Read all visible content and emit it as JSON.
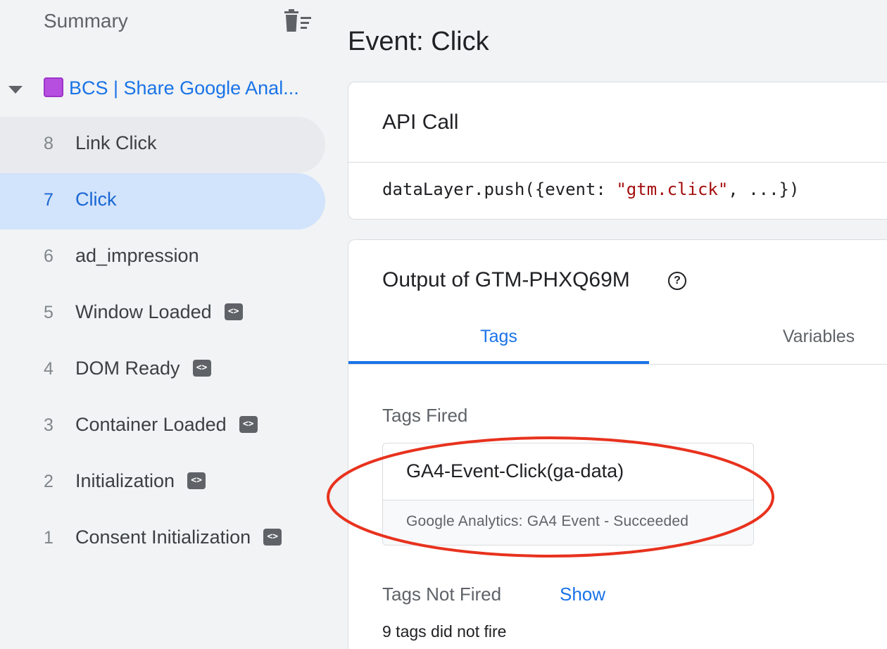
{
  "sidebar": {
    "summary_label": "Summary",
    "container_label": "BCS | Share Google Anal...",
    "events": [
      {
        "num": "8",
        "label": "Link Click",
        "badge": false,
        "state": "hover"
      },
      {
        "num": "7",
        "label": "Click",
        "badge": false,
        "state": "active"
      },
      {
        "num": "6",
        "label": "ad_impression",
        "badge": false,
        "state": ""
      },
      {
        "num": "5",
        "label": "Window Loaded",
        "badge": true,
        "state": ""
      },
      {
        "num": "4",
        "label": "DOM Ready",
        "badge": true,
        "state": ""
      },
      {
        "num": "3",
        "label": "Container Loaded",
        "badge": true,
        "state": ""
      },
      {
        "num": "2",
        "label": "Initialization",
        "badge": true,
        "state": ""
      },
      {
        "num": "1",
        "label": "Consent Initialization",
        "badge": true,
        "state": ""
      }
    ],
    "badge_glyph": "<>"
  },
  "main": {
    "title": "Event: Click",
    "api_card": {
      "title": "API Call",
      "code_prefix": "dataLayer.push({event: ",
      "code_string": "\"gtm.click\"",
      "code_suffix": ", ...})"
    },
    "output_card": {
      "title": "Output of GTM-PHXQ69M",
      "help_glyph": "?",
      "tabs": {
        "tags": "Tags",
        "variables": "Variables"
      },
      "tags_fired_label": "Tags Fired",
      "fired_tag": {
        "name": "GA4-Event-Click(ga-data)",
        "status": "Google Analytics: GA4 Event - Succeeded"
      },
      "tags_not_fired_label": "Tags Not Fired",
      "show_link": "Show",
      "not_fired_count": "9 tags did not fire"
    }
  },
  "colors": {
    "accent": "#1a73e8",
    "active_bg": "#d2e3fc",
    "annotation": "#e8321e",
    "container_square": "#b64fe0"
  }
}
